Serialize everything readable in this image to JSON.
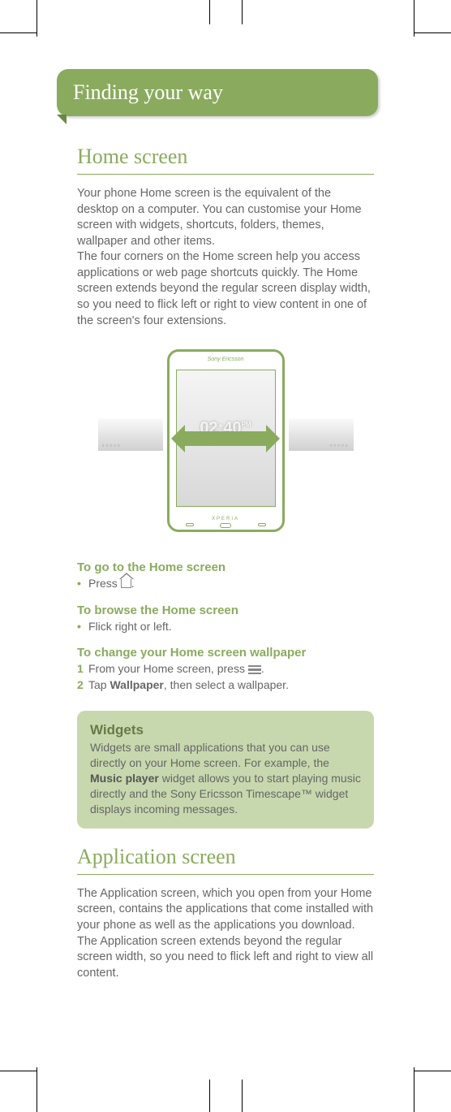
{
  "chapter": {
    "title": "Finding your way"
  },
  "home_section": {
    "title": "Home screen",
    "para": "Your phone Home screen is the equivalent of the desktop on a computer. You can customise your Home screen with widgets, shortcuts, folders, themes, wallpaper and other items.\nThe four corners on the Home screen help you access applications or web page shortcuts quickly. The Home screen extends beyond the regular screen display width, so you need to flick left or right to view content in one of the screen's four extensions."
  },
  "illustration": {
    "brand": "Sony Ericsson",
    "sub_brand": "XPERIA",
    "clock": "02:40",
    "clock_suffix": "PM"
  },
  "instructions": {
    "goto_home": {
      "heading": "To go to the Home screen",
      "step": "Press ",
      "step_end": "."
    },
    "browse_home": {
      "heading": "To browse the Home screen",
      "step": "Flick right or left."
    },
    "change_wallpaper": {
      "heading": "To change your Home screen wallpaper",
      "step1_pre": "From your Home screen, press ",
      "step1_post": ".",
      "step2_pre": "Tap ",
      "step2_bold": "Wallpaper",
      "step2_post": ", then select a wallpaper."
    }
  },
  "widgets_callout": {
    "title": "Widgets",
    "text_pre": "Widgets are small applications that you can use directly on your Home screen. For example, the ",
    "text_bold": "Music player",
    "text_post": " widget allows you to start playing music directly and the Sony Ericsson Timescape™ widget displays incoming messages."
  },
  "app_section": {
    "title": "Application screen",
    "para": "The Application screen, which you open from your Home screen, contains the applications that come installed with your phone as well as the applications you download.\nThe Application screen extends beyond the regular screen width, so you need to flick left and right to view all content."
  }
}
